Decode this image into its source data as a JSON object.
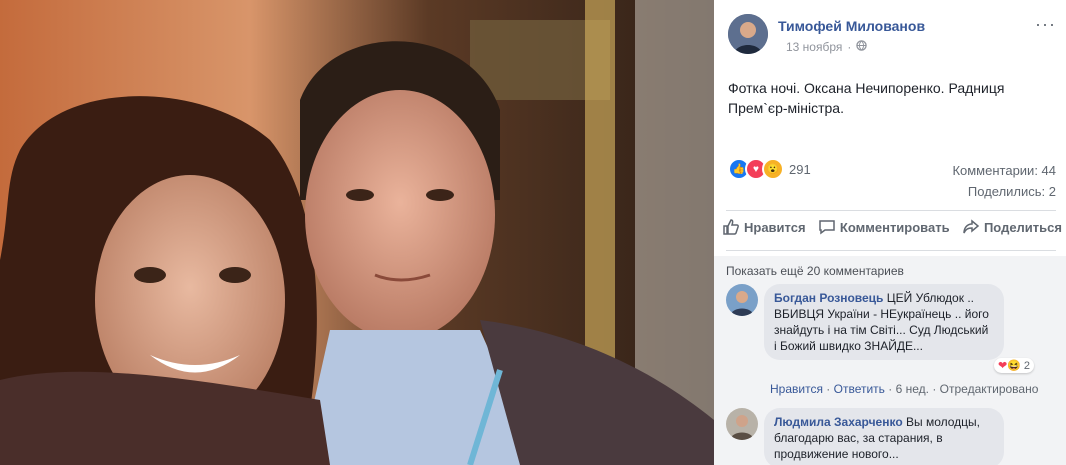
{
  "post": {
    "author": "Тимофей Милованов",
    "date": "13 ноября",
    "privacy_icon": "globe-icon",
    "text_line1": "Фотка ночі. Оксана Нечипоренко. Радниця",
    "text_line2": "Прем`єр-міністра.",
    "reactions_count": "291",
    "comments_count": "Комментарии: 44",
    "shares_count": "Поделились: 2"
  },
  "actions": {
    "like": "Нравится",
    "comment": "Комментировать",
    "share": "Поделиться"
  },
  "comments": {
    "show_more": "Показать ещё 20 комментариев",
    "items": [
      {
        "name": "Богдан Розновець",
        "text": "ЦЕЙ Ублюдок .. ВБИВЦЯ України - НЕукраїнець .. його знайдуть і на тім Світі... Суд Людський і Божий швидко ЗНАЙДЕ...",
        "reaction_count": "2",
        "like": "Нравится",
        "reply": "Ответить",
        "time": "6 нед.",
        "edited": "Отредактировано"
      },
      {
        "name": "Людмила Захарченко",
        "text": "Вы молодцы, благодарю вас, за старания, в продвижение нового..."
      }
    ]
  },
  "colors": {
    "link": "#385898",
    "like_blue": "#1877f2",
    "love_red": "#f33e58",
    "wow_yellow": "#f7b125"
  }
}
